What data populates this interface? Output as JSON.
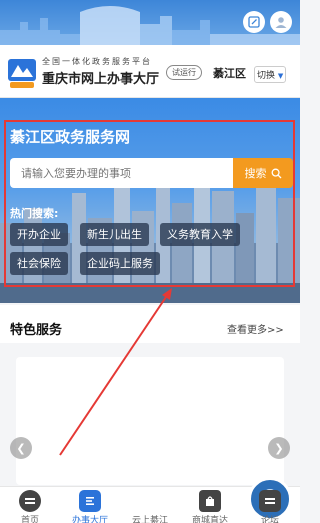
{
  "header": {
    "edit_icon": "edit-icon",
    "user_icon": "user-icon"
  },
  "portal": {
    "subtitle": "全国一体化政务服务平台",
    "title": "重庆市网上办事大厅",
    "badge": "试运行",
    "district": "綦江区",
    "switch_label": "切换"
  },
  "hero": {
    "title": "綦江区政务服务网",
    "search_placeholder": "请输入您要办理的事项",
    "search_button": "搜索",
    "hot_label": "热门搜索:",
    "tags": [
      "开办企业",
      "新生儿出生",
      "义务教育入学",
      "社会保险",
      "企业码上服务"
    ]
  },
  "featured": {
    "title": "特色服务",
    "more": "查看更多>>"
  },
  "nav": {
    "items": [
      {
        "label": "首页",
        "icon": "home-icon"
      },
      {
        "label": "办事大厅",
        "icon": "service-hall-icon"
      },
      {
        "label": "云上綦江",
        "icon": "cloud-qijiang-icon"
      },
      {
        "label": "商城直达",
        "icon": "shop-bag-icon"
      },
      {
        "label": "论坛",
        "icon": "forum-icon"
      }
    ],
    "active_index": 1
  },
  "colors": {
    "primary": "#2b73d9",
    "search_button": "#f39a1f",
    "highlight_box": "#e53935"
  }
}
